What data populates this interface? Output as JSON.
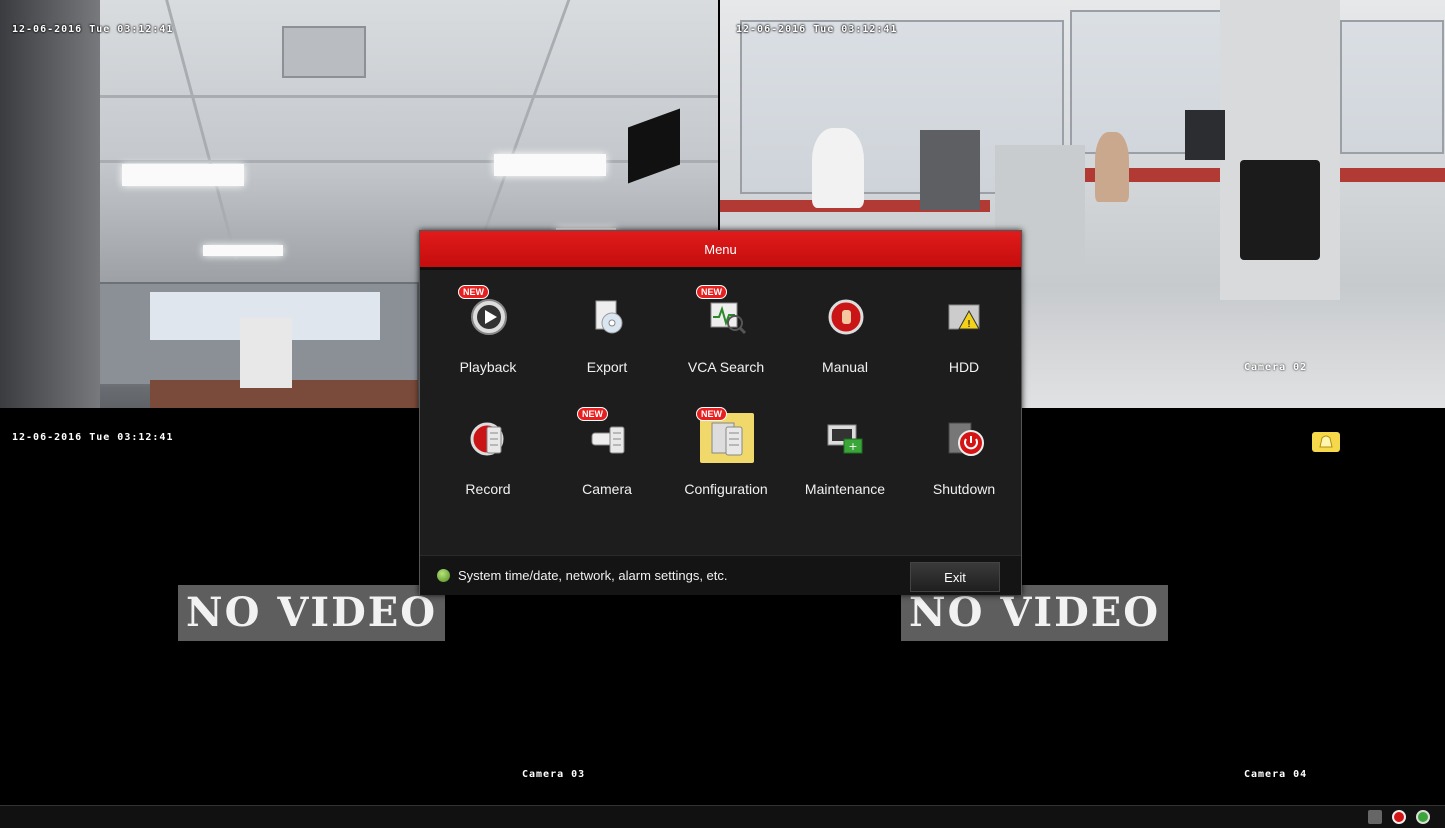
{
  "cameras": [
    {
      "timestamp": "12-06-2016 Tue 03:12:41",
      "name": ""
    },
    {
      "timestamp": "12-06-2016 Tue 03:12:41",
      "name": "Camera 02"
    },
    {
      "timestamp": "12-06-2016 Tue 03:12:41",
      "name": "Camera 03",
      "no_video": "NO VIDEO"
    },
    {
      "timestamp": "",
      "name": "Camera 04",
      "no_video": "NO VIDEO"
    }
  ],
  "menu": {
    "title": "Menu",
    "items": [
      {
        "label": "Playback",
        "icon": "playback-icon",
        "badge": "NEW"
      },
      {
        "label": "Export",
        "icon": "export-icon",
        "badge": ""
      },
      {
        "label": "VCA Search",
        "icon": "vca-search-icon",
        "badge": "NEW"
      },
      {
        "label": "Manual",
        "icon": "manual-record-icon",
        "badge": ""
      },
      {
        "label": "HDD",
        "icon": "hdd-icon",
        "badge": ""
      },
      {
        "label": "Record",
        "icon": "record-icon",
        "badge": ""
      },
      {
        "label": "Camera",
        "icon": "camera-icon",
        "badge": "NEW"
      },
      {
        "label": "Configuration",
        "icon": "configuration-icon",
        "badge": "NEW",
        "selected": true
      },
      {
        "label": "Maintenance",
        "icon": "maintenance-icon",
        "badge": ""
      },
      {
        "label": "Shutdown",
        "icon": "shutdown-icon",
        "badge": ""
      }
    ],
    "hint": "System time/date, network, alarm settings, etc.",
    "exit_label": "Exit"
  },
  "colors": {
    "title_bar": "#d41414",
    "selected_tile": "#f0d96a",
    "no_video_bg": "#5e5e5e"
  }
}
